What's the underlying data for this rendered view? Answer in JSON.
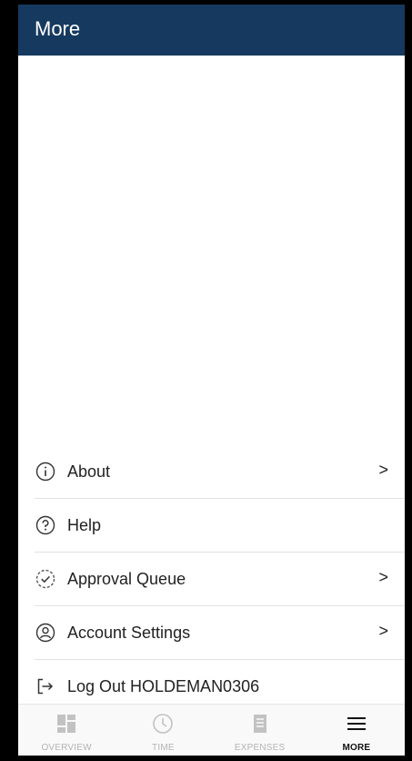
{
  "header": {
    "title": "More"
  },
  "menu": {
    "items": [
      {
        "label": "About",
        "icon": "info-icon",
        "has_chevron": true
      },
      {
        "label": "Help",
        "icon": "question-icon",
        "has_chevron": false
      },
      {
        "label": "Approval Queue",
        "icon": "approval-check-icon",
        "has_chevron": true
      },
      {
        "label": "Account Settings",
        "icon": "account-icon",
        "has_chevron": true
      },
      {
        "label": "Log Out HOLDEMAN0306",
        "icon": "logout-icon",
        "has_chevron": false
      }
    ],
    "chevron": ">"
  },
  "tabs": [
    {
      "label": "OVERVIEW",
      "icon": "dashboard-icon",
      "active": false
    },
    {
      "label": "TIME",
      "icon": "clock-icon",
      "active": false
    },
    {
      "label": "EXPENSES",
      "icon": "receipt-icon",
      "active": false
    },
    {
      "label": "MORE",
      "icon": "hamburger-menu-icon",
      "active": true
    }
  ],
  "colors": {
    "header_bg": "#163a5f",
    "inactive_tab": "#b3b3b3",
    "active_tab": "#111111"
  }
}
